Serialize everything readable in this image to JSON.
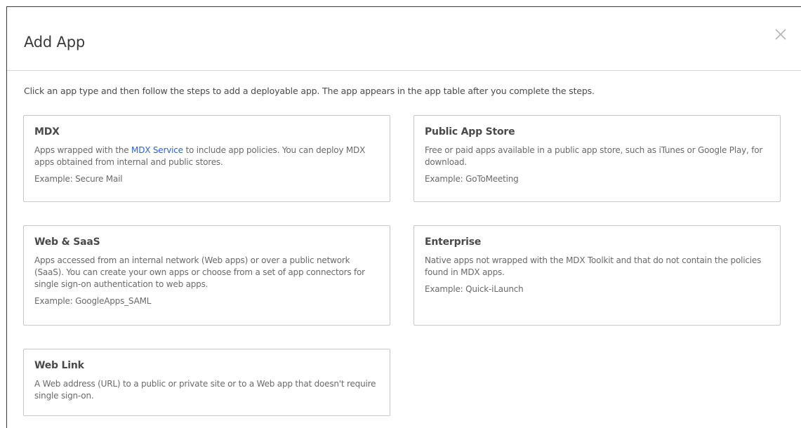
{
  "dialog": {
    "title": "Add App",
    "intro": "Click an app type and then follow the steps to add a deployable app. The app appears in the app table after you complete the steps."
  },
  "cards": {
    "mdx": {
      "title": "MDX",
      "desc_before": "Apps wrapped with the ",
      "desc_link": "MDX Service",
      "desc_after": " to include app policies. You can deploy MDX apps obtained from internal and public stores.",
      "example": "Example: Secure Mail"
    },
    "public_store": {
      "title": "Public App Store",
      "desc": "Free or paid apps available in a public app store, such as iTunes or Google Play, for download.",
      "example": "Example: GoToMeeting"
    },
    "web_saas": {
      "title": "Web & SaaS",
      "desc": "Apps accessed from an internal network (Web apps) or over a public network (SaaS). You can create your own apps or choose from a set of app connectors for single sign-on authentication to web apps.",
      "example": "Example: GoogleApps_SAML"
    },
    "enterprise": {
      "title": "Enterprise",
      "desc": "Native apps not wrapped with the MDX Toolkit and that do not contain the policies found in MDX apps.",
      "example": "Example: Quick-iLaunch"
    },
    "web_link": {
      "title": "Web Link",
      "desc": "A Web address (URL) to a public or private site or to a Web app that doesn't require single sign-on."
    }
  },
  "icons": {
    "close": "close-icon"
  },
  "colors": {
    "link": "#2e5fd6",
    "border": "#c8c8c8"
  }
}
